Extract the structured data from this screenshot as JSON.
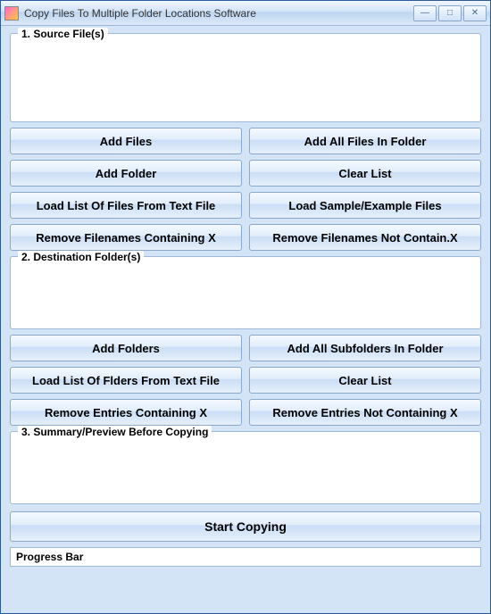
{
  "window": {
    "title": "Copy Files To Multiple Folder Locations Software"
  },
  "section1": {
    "label": "1. Source File(s)",
    "buttons": {
      "add_files": "Add Files",
      "add_all_in_folder": "Add All Files In Folder",
      "add_folder": "Add Folder",
      "clear_list": "Clear List",
      "load_from_text": "Load List Of Files From Text File",
      "load_sample": "Load Sample/Example Files",
      "remove_containing_x": "Remove Filenames Containing X",
      "remove_not_containing_x": "Remove Filenames Not Contain.X"
    }
  },
  "section2": {
    "label": "2. Destination Folder(s)",
    "buttons": {
      "add_folders": "Add Folders",
      "add_all_subfolders": "Add All Subfolders In Folder",
      "load_folders_from_text": "Load List Of Flders From Text File",
      "clear_list": "Clear List",
      "remove_containing_x": "Remove Entries Containing X",
      "remove_not_containing_x": "Remove Entries Not Containing X"
    }
  },
  "section3": {
    "label": "3. Summary/Preview Before Copying"
  },
  "actions": {
    "start_copying": "Start Copying"
  },
  "progress": {
    "label": "Progress Bar"
  }
}
